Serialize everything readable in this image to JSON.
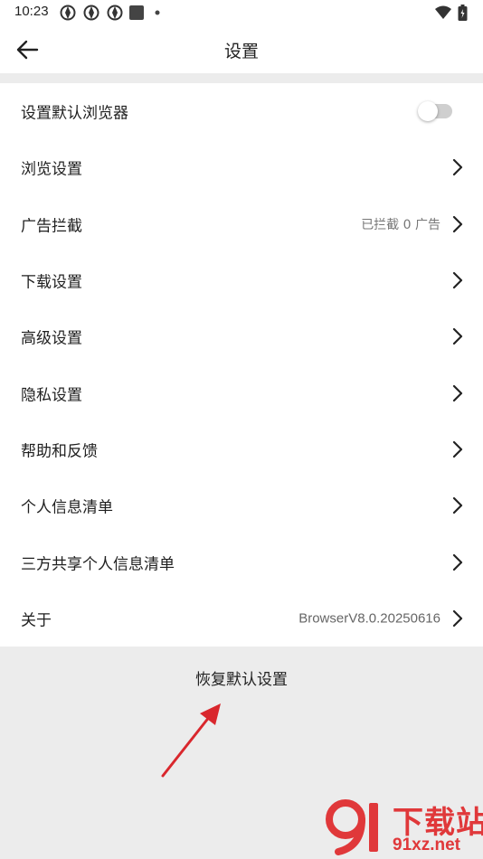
{
  "status_bar": {
    "time": "10:23"
  },
  "header": {
    "title": "设置"
  },
  "settings": {
    "items": [
      {
        "label": "设置默认浏览器"
      },
      {
        "label": "浏览设置"
      },
      {
        "label": "广告拦截",
        "value": "已拦截 0 广告"
      },
      {
        "label": "下载设置"
      },
      {
        "label": "高级设置"
      },
      {
        "label": "隐私设置"
      },
      {
        "label": "帮助和反馈"
      },
      {
        "label": "个人信息清单"
      },
      {
        "label": "三方共享个人信息清单"
      },
      {
        "label": "关于",
        "value": "BrowserV8.0.20250616"
      }
    ],
    "default_browser_toggle": "off"
  },
  "reset": {
    "label": "恢复默认设置"
  },
  "watermark": {
    "text": "下载站",
    "domain": "91xz.net"
  },
  "colors": {
    "accent": "#e0383a",
    "background": "#ececec",
    "card": "#ffffff"
  }
}
